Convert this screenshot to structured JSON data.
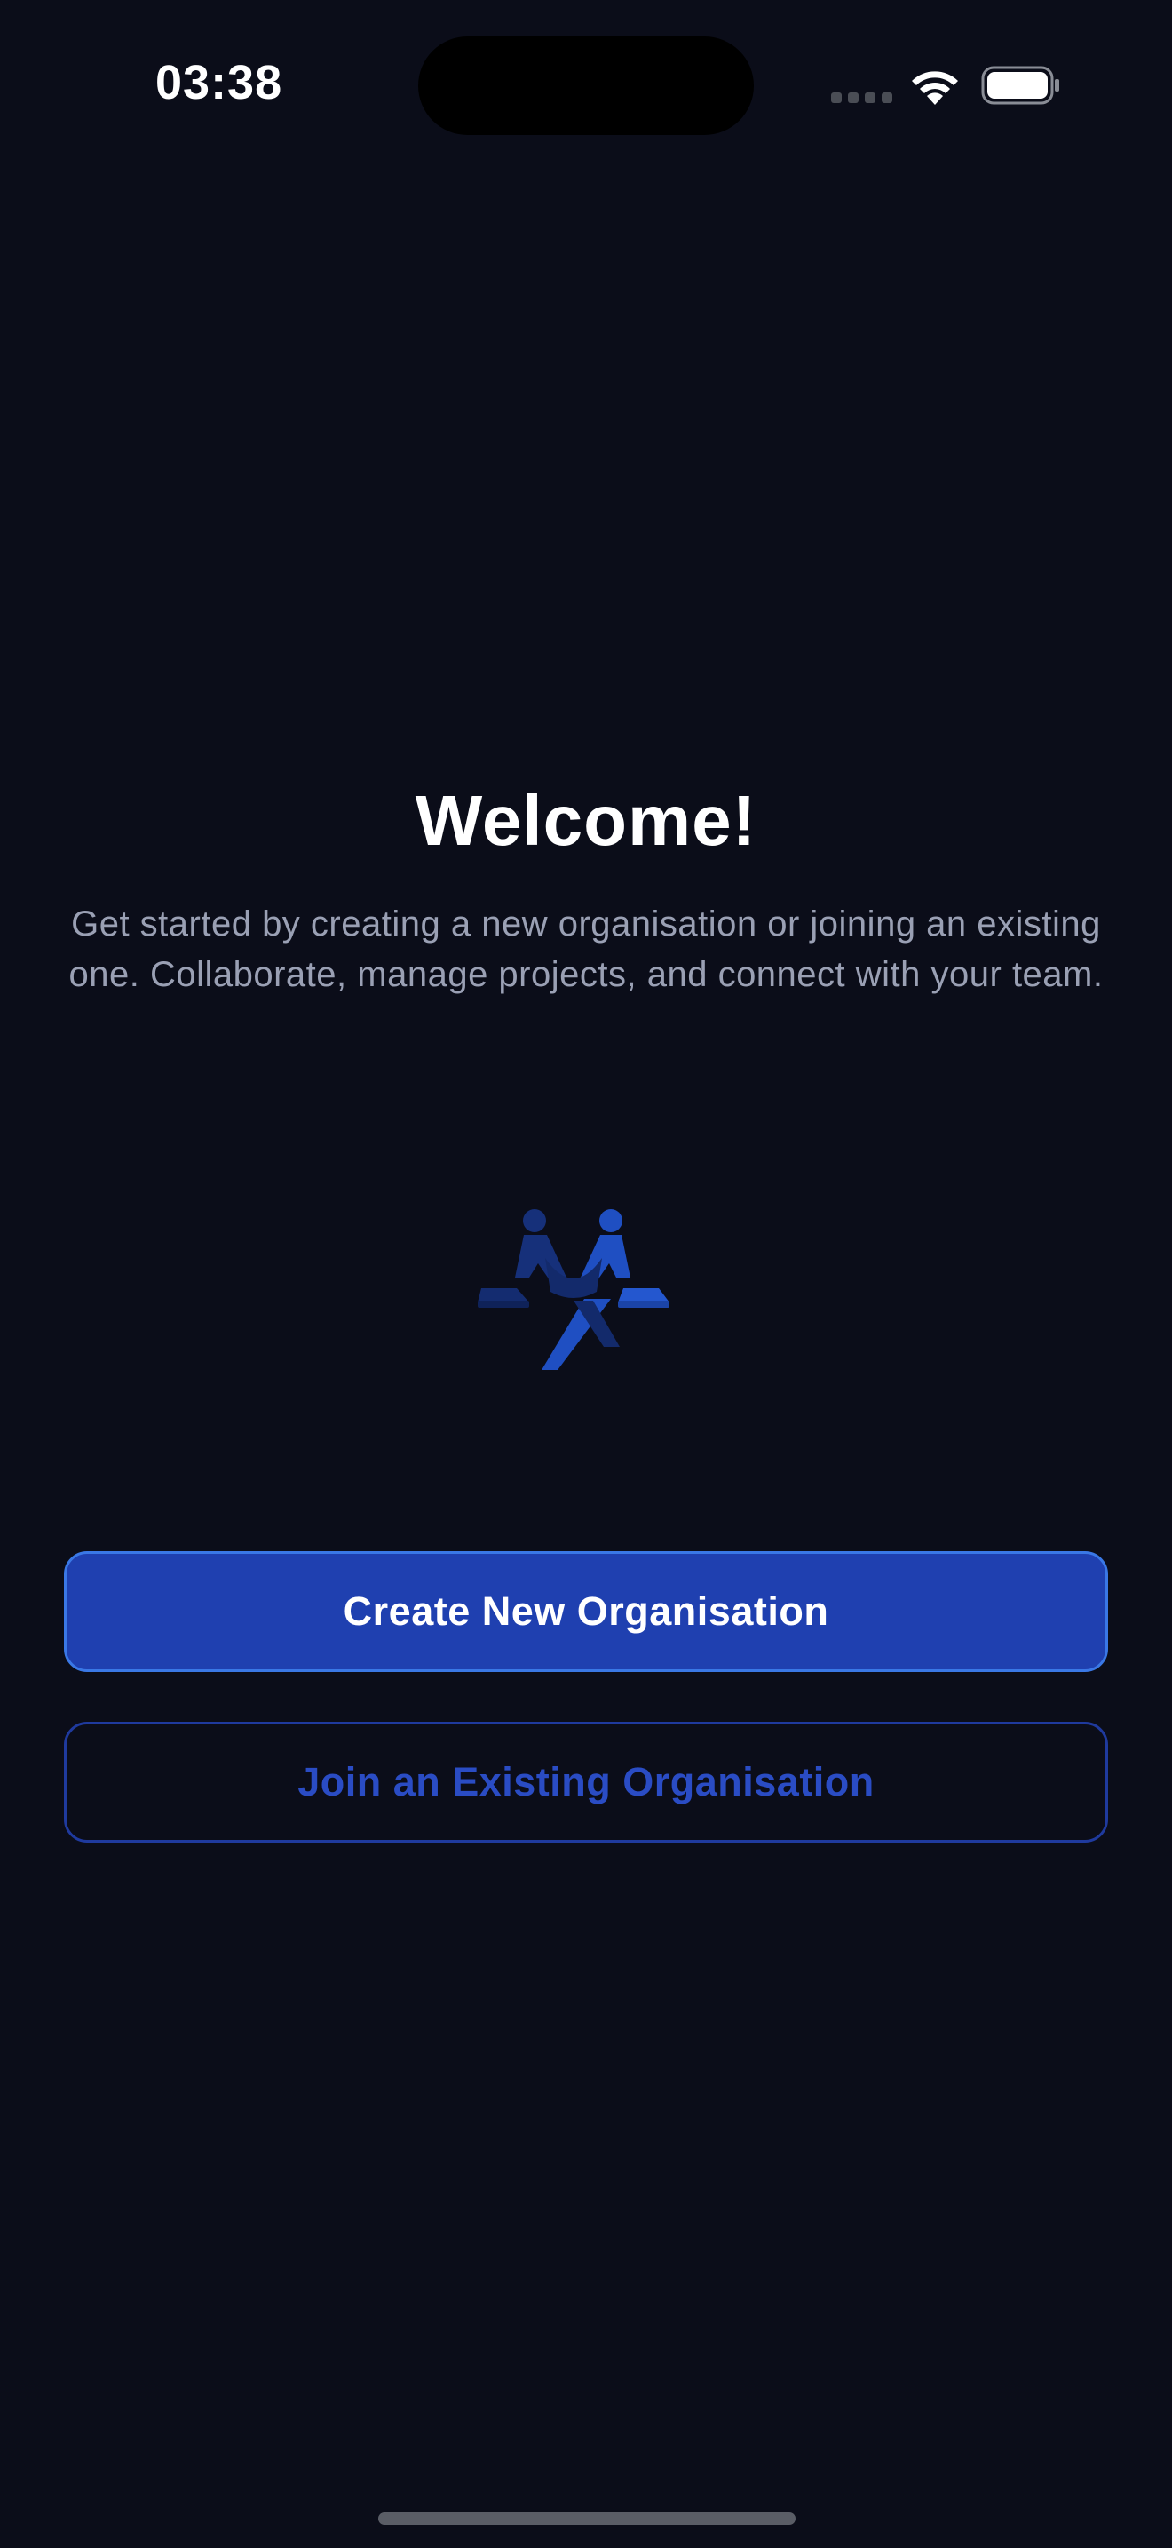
{
  "status_bar": {
    "time": "03:38",
    "icons": [
      "signal-icon",
      "wifi-icon",
      "battery-icon"
    ]
  },
  "welcome": {
    "title": "Welcome!",
    "subtitle": "Get started by creating a new organisation or joining an existing one. Collaborate, manage projects, and connect with your team."
  },
  "illustration": {
    "icon": "team-collaboration-illustration"
  },
  "actions": {
    "create_label": "Create New Organisation",
    "join_label": "Join an Existing Organisation"
  },
  "colors": {
    "background": "#0b0d19",
    "primary": "#1f40b0",
    "primary_border": "#3a78e6",
    "secondary_text": "#2a4cc4",
    "subtitle_text": "#9aa0b4"
  }
}
